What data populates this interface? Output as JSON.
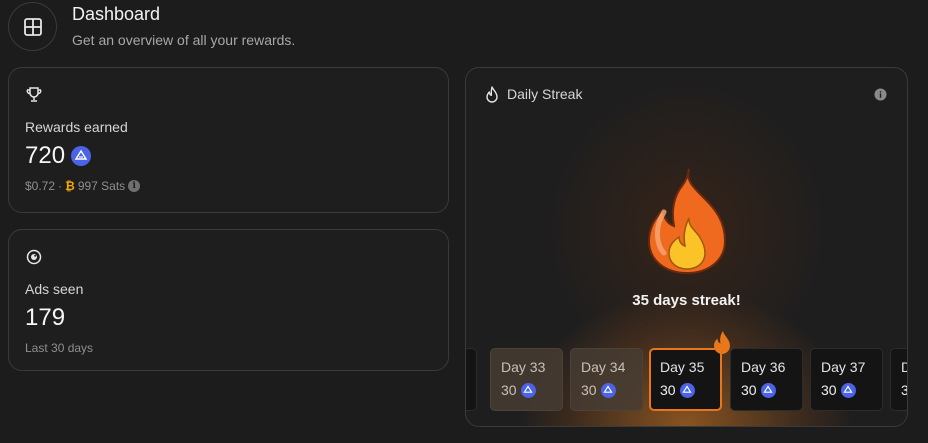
{
  "header": {
    "title": "Dashboard",
    "subtitle": "Get an overview of all your rewards."
  },
  "rewards_card": {
    "label": "Rewards earned",
    "value": "720",
    "usd": "$0.72",
    "separator": "·",
    "sats": "997 Sats"
  },
  "ads_card": {
    "label": "Ads seen",
    "value": "179",
    "period": "Last 30 days"
  },
  "streak_card": {
    "title": "Daily Streak",
    "message": "35 days streak!",
    "days": [
      {
        "label": "Day 33",
        "points": "30",
        "state": "past"
      },
      {
        "label": "Day 34",
        "points": "30",
        "state": "past"
      },
      {
        "label": "Day 35",
        "points": "30",
        "state": "current"
      },
      {
        "label": "Day 36",
        "points": "30",
        "state": "future"
      },
      {
        "label": "Day 37",
        "points": "30",
        "state": "future"
      },
      {
        "label": "D",
        "points": "3",
        "state": "future"
      }
    ]
  },
  "colors": {
    "accent_orange": "#e8771c",
    "token_blue": "#4b63e6",
    "background": "#1c1c1c"
  },
  "icons": [
    "grid-icon",
    "trophy-icon",
    "eye-icon",
    "flame-icon",
    "info-icon",
    "bat-token-icon",
    "bitcoin-icon"
  ]
}
